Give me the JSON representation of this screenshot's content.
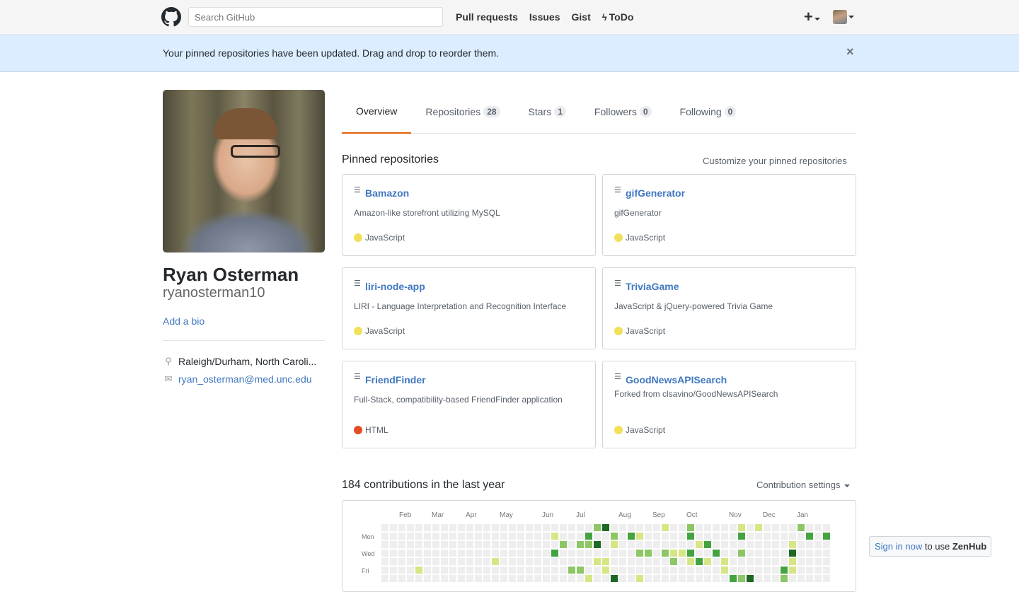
{
  "header": {
    "search_placeholder": "Search GitHub",
    "nav": [
      "Pull requests",
      "Issues",
      "Gist",
      "ToDo"
    ],
    "plus_label": "+"
  },
  "flash": {
    "message": "Your pinned repositories have been updated. Drag and drop to reorder them.",
    "close": "×"
  },
  "profile": {
    "name": "Ryan Osterman",
    "username": "ryanosterman10",
    "add_bio": "Add a bio",
    "location": "Raleigh/Durham, North Caroli...",
    "email": "ryan_osterman@med.unc.edu"
  },
  "tabs": [
    {
      "label": "Overview",
      "count": ""
    },
    {
      "label": "Repositories",
      "count": "28"
    },
    {
      "label": "Stars",
      "count": "1"
    },
    {
      "label": "Followers",
      "count": "0"
    },
    {
      "label": "Following",
      "count": "0"
    }
  ],
  "pinned": {
    "title": "Pinned repositories",
    "customize": "Customize your pinned repositories",
    "repos": [
      {
        "name": "Bamazon",
        "description": "Amazon-like storefront utilizing MySQL",
        "language": "JavaScript",
        "color": "#f1e05a"
      },
      {
        "name": "gifGenerator",
        "description": "gifGenerator",
        "language": "JavaScript",
        "color": "#f1e05a"
      },
      {
        "name": "liri-node-app",
        "description": "LIRI - Language Interpretation and Recognition Interface",
        "language": "JavaScript",
        "color": "#f1e05a"
      },
      {
        "name": "TriviaGame",
        "description": "JavaScript & jQuery-powered Trivia Game",
        "language": "JavaScript",
        "color": "#f1e05a"
      },
      {
        "name": "FriendFinder",
        "description": "Full-Stack, compatibility-based FriendFinder application",
        "language": "HTML",
        "color": "#e34c26"
      },
      {
        "name": "GoodNewsAPISearch",
        "description": "Forked from clsavino/GoodNewsAPISearch",
        "language": "JavaScript",
        "color": "#f1e05a"
      }
    ]
  },
  "contributions": {
    "title": "184 contributions in the last year",
    "settings": "Contribution settings",
    "months": [
      "Feb",
      "Mar",
      "Apr",
      "May",
      "Jun",
      "Jul",
      "Aug",
      "Sep",
      "Oct",
      "Nov",
      "Dec",
      "Jan"
    ],
    "days": [
      "Mon",
      "Wed",
      "Fri"
    ],
    "colors": [
      "#eeeeee",
      "#d6e685",
      "#8cc665",
      "#44a340",
      "#1e6823"
    ]
  },
  "zenhub": {
    "link": "Sign in now",
    "text": " to use ",
    "brand": "ZenHub"
  }
}
